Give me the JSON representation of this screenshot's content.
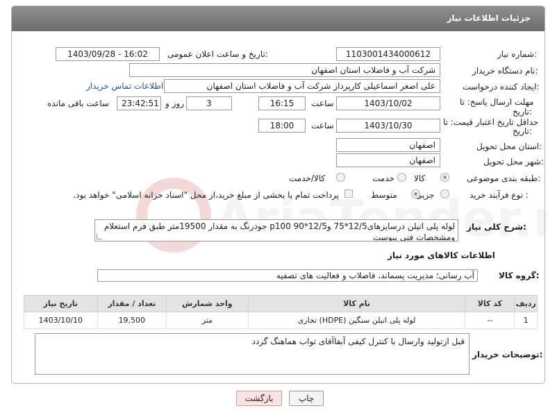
{
  "header": {
    "title": "جزئیات اطلاعات نیاز"
  },
  "labels": {
    "need_number": "شماره نیاز:",
    "announce_datetime": "تاریخ و ساعت اعلان عمومی:",
    "buyer_org": "نام دستگاه خریدار:",
    "requester": "ایجاد کننده درخواست:",
    "reply_deadline": "مهلت ارسال پاسخ: تا تاریخ:",
    "reply_deadline_line1": "مهلت ارسال پاسخ: تا",
    "reply_deadline_line2": "تاریخ:",
    "price_validity_line1": "حداقل تاریخ اعتبار قیمت: تا",
    "price_validity_line2": "تاریخ:",
    "time": "ساعت",
    "days_and": "روز و",
    "remaining": "ساعت باقی مانده",
    "delivery_province": "استان محل تحویل:",
    "delivery_city": "شهر محل تحویل:",
    "category": "طبقه بندی موضوعی:",
    "process_type": "نوع فرآیند خرید :",
    "general_desc": "شرح کلی نیاز:",
    "goods_info": "اطلاعات کالاهای مورد نیاز",
    "goods_group": "گروه کالا:",
    "buyer_notes": "توضیحات خریدار:"
  },
  "values": {
    "need_number": "1103001434000612",
    "announce_datetime": "1403/09/28 - 16:02",
    "buyer_org": "شرکت آب و فاضلاب استان اصفهان",
    "requester": "علی اصغر اسماعیلی کارپرداز شرکت آب و فاضلاب استان اصفهان",
    "contact_link": "اطلاعات تماس خریدار",
    "reply_date": "1403/10/02",
    "reply_time": "16:15",
    "reply_days": "3",
    "reply_remaining": "23:42:51",
    "price_date": "1403/10/30",
    "price_time": "18:00",
    "delivery_province": "اصفهان",
    "delivery_city": "اصفهان",
    "general_desc": "لوله پلی اتیلن درسایزهای12/5*75 و12/5*90 p100 جودرنگ به مقدار 19500متر طبق فرم استعلام ومشخصات فنی پیوست",
    "goods_group": "آب رسانی؛ مدیریت پسماند، فاضلاب و فعالیت های تصفیه",
    "buyer_notes": "قبل ازتولید وارسال با کنترل کیفی آبفاآقای تواب هماهنگ گردد"
  },
  "category_options": [
    "کالا",
    "خدمت",
    "کالا/خدمت"
  ],
  "process_options": [
    "جزیی",
    "متوسط"
  ],
  "payment_note": "پرداخت تمام یا بخشی از مبلغ خرید،از محل \"اسناد خزانه اسلامی\" خواهد بود.",
  "table": {
    "headers": [
      "ردیف",
      "کد کالا",
      "نام کالا",
      "واحد شمارش",
      "تعداد / مقدار",
      "تاریخ نیاز"
    ],
    "rows": [
      [
        "1",
        "--",
        "لوله پلی اتیلن سنگین (HDPE) تجاری",
        "متر",
        "19,500",
        "1403/10/10"
      ]
    ]
  },
  "buttons": {
    "print": "چاپ",
    "back": "بازگشت"
  },
  "watermark": "AriaTender.net"
}
